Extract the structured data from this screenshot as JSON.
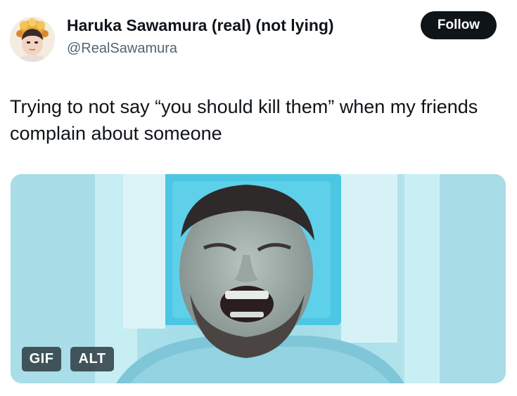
{
  "author": {
    "display_name": "Haruka Sawamura (real) (not lying)",
    "handle": "@RealSawamura"
  },
  "follow_button": {
    "label": "Follow"
  },
  "tweet": {
    "text": "Trying to not say “you should kill them” when my friends complain about someone"
  },
  "media": {
    "gif_badge": "GIF",
    "alt_badge": "ALT"
  },
  "colors": {
    "text_primary": "#0f1419",
    "text_secondary": "#536471",
    "follow_bg": "#0f1419",
    "media_tint": "#a6e0ea"
  }
}
